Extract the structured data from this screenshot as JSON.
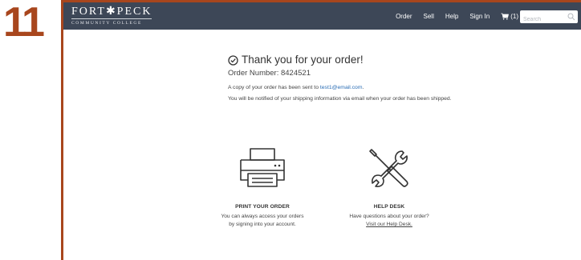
{
  "step": {
    "number": "11"
  },
  "header": {
    "logo_main": "FORT✱PECK",
    "logo_sub": "COMMUNITY COLLEGE",
    "nav": [
      {
        "label": "Order"
      },
      {
        "label": "Sell"
      },
      {
        "label": "Help"
      },
      {
        "label": "Sign In"
      }
    ],
    "cart_label": "(1)",
    "cart_icon": "cart-icon",
    "search_placeholder": "Search",
    "search_icon": "search-icon"
  },
  "confirmation": {
    "title": "Thank you for your order!",
    "title_icon": "check-circle-icon",
    "order_number": "Order Number: 8424521",
    "copy_text": "A copy of your order has been sent to ",
    "email": "test1@email.com",
    "copy_suffix": ".",
    "notify_text": "You will be notified of your shipping information via email when your order has been shipped."
  },
  "cards": {
    "print": {
      "icon": "printer-icon",
      "title": "PRINT YOUR ORDER",
      "line1": "You can always access your orders",
      "line2": "by signing into your account."
    },
    "help": {
      "icon": "tools-icon",
      "title": "HELP DESK",
      "line1": "Have questions about your order?",
      "link": "Visit our Help Desk."
    }
  },
  "colors": {
    "step_accent": "#a8461d",
    "navbar": "#3d4757",
    "link": "#2a6db5"
  }
}
